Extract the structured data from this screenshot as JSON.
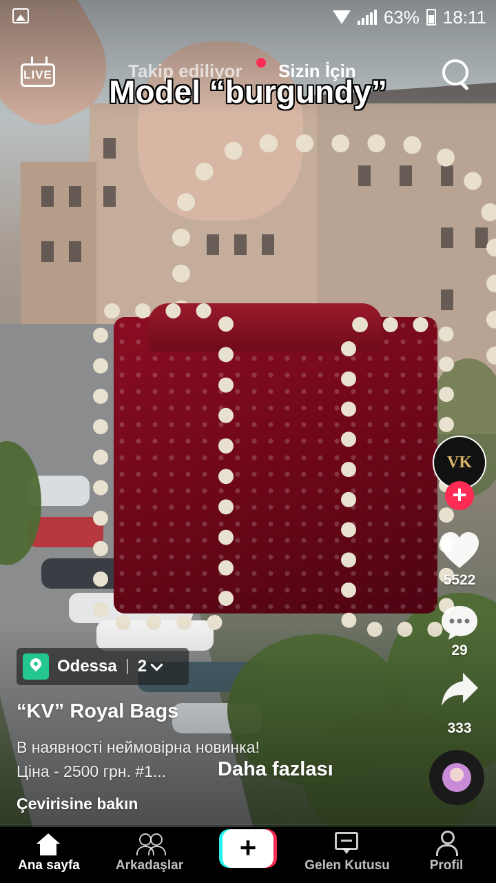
{
  "status_bar": {
    "battery": "63%",
    "time": "18:11",
    "icons": [
      "gallery-icon",
      "wifi-icon",
      "signal-icon",
      "battery-icon"
    ]
  },
  "top_nav": {
    "live_label": "LIVE",
    "tabs": [
      {
        "label": "Takip ediliyor",
        "active": false
      },
      {
        "label": "Sizin İçin",
        "active": true
      }
    ],
    "search_icon": "search-icon"
  },
  "video": {
    "overlay_text": "Model “burgundy”"
  },
  "actions": {
    "avatar_monogram": "VK",
    "likes": "5522",
    "comments": "29",
    "shares": "333",
    "icons": [
      "plus-icon",
      "heart-icon",
      "comment-icon",
      "share-icon",
      "music-disc-icon"
    ],
    "accent_color": "#fe2c55"
  },
  "info": {
    "location": {
      "name": "Odessa",
      "count": "2"
    },
    "author": "“KV” Royal Bags",
    "description_line1": "В наявності неймовірна новинка!",
    "description_line2": "Ціна - 2500 грн. #1...",
    "more_label": "Daha fazlası",
    "translate_label": "Çevirisine bakın"
  },
  "bottom_nav": {
    "items": [
      {
        "label": "Ana sayfa",
        "icon": "home-icon",
        "active": true
      },
      {
        "label": "Arkadaşlar",
        "icon": "friends-icon",
        "active": false
      },
      {
        "label": "",
        "icon": "plus-icon",
        "active": false
      },
      {
        "label": "Gelen Kutusu",
        "icon": "inbox-icon",
        "active": false
      },
      {
        "label": "Profil",
        "icon": "profile-icon",
        "active": false
      }
    ]
  }
}
